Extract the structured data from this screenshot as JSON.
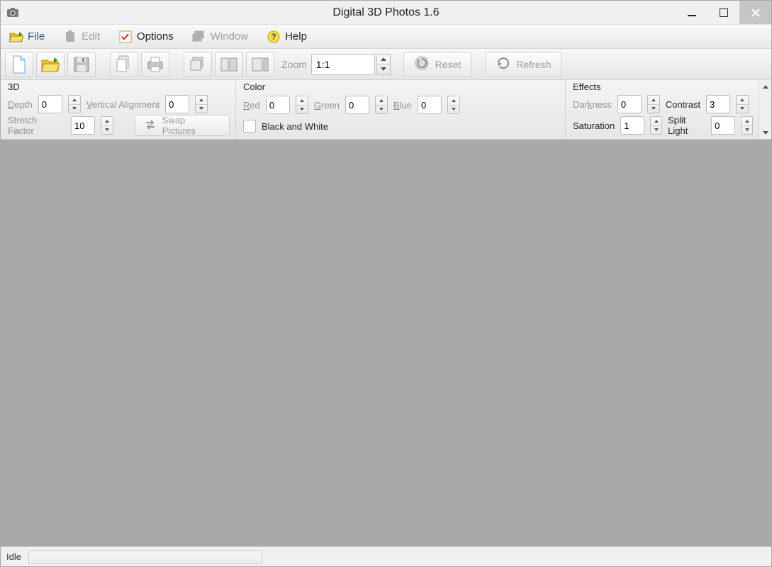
{
  "title": "Digital 3D Photos 1.6",
  "menu": {
    "file": {
      "label": "File",
      "enabled": true
    },
    "edit": {
      "label": "Edit",
      "enabled": false
    },
    "options": {
      "label": "Options",
      "enabled": true
    },
    "window": {
      "label": "Window",
      "enabled": false
    },
    "help": {
      "label": "Help",
      "enabled": true
    }
  },
  "toolbar": {
    "zoom_label": "Zoom",
    "zoom_value": "1:1",
    "reset_label": "Reset",
    "refresh_label": "Refresh"
  },
  "panels": {
    "three_d": {
      "title": "3D",
      "depth_label": "Depth",
      "depth": "0",
      "valign_label": "Vertical Alignment",
      "valign": "0",
      "stretch_label": "Stretch Factor",
      "stretch": "10",
      "swap_label": "Swap Pictures"
    },
    "color": {
      "title": "Color",
      "red_label": "Red",
      "red": "0",
      "green_label": "Green",
      "green": "0",
      "blue_label": "Blue",
      "blue": "0",
      "bw_label": "Black and White"
    },
    "effects": {
      "title": "Effects",
      "darkness_label": "Darkness",
      "darkness": "0",
      "contrast_label": "Contrast",
      "contrast": "3",
      "saturation_label": "Saturation",
      "saturation": "1",
      "splitlight_label": "Split Light",
      "splitlight": "0"
    }
  },
  "status": {
    "text": "Idle"
  }
}
